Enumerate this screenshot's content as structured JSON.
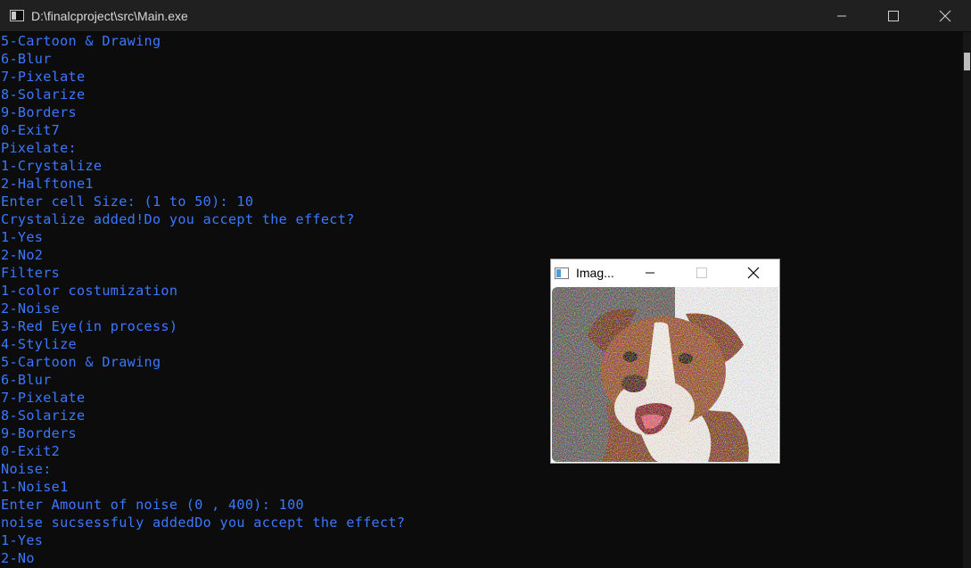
{
  "window": {
    "title": "D:\\finalcproject\\src\\Main.exe",
    "icon": "console-app-icon"
  },
  "console": {
    "text_color": "#3b78ff",
    "background": "#0c0c0c",
    "lines": [
      "5-Cartoon & Drawing",
      "6-Blur",
      "7-Pixelate",
      "8-Solarize",
      "9-Borders",
      "0-Exit7",
      "Pixelate:",
      "1-Crystalize",
      "2-Halftone1",
      "Enter cell Size: (1 to 50): 10",
      "Crystalize added!Do you accept the effect?",
      "1-Yes",
      "2-No2",
      "Filters",
      "1-color costumization",
      "2-Noise",
      "3-Red Eye(in process)",
      "4-Stylize",
      "5-Cartoon & Drawing",
      "6-Blur",
      "7-Pixelate",
      "8-Solarize",
      "9-Borders",
      "0-Exit2",
      "Noise:",
      "1-Noise1",
      "Enter Amount of noise (0 , 400): 100",
      "noise sucsessfuly addedDo you accept the effect?",
      "1-Yes",
      "2-No"
    ]
  },
  "image_window": {
    "title": "Imag...",
    "content": "noisy-dog-photo"
  }
}
